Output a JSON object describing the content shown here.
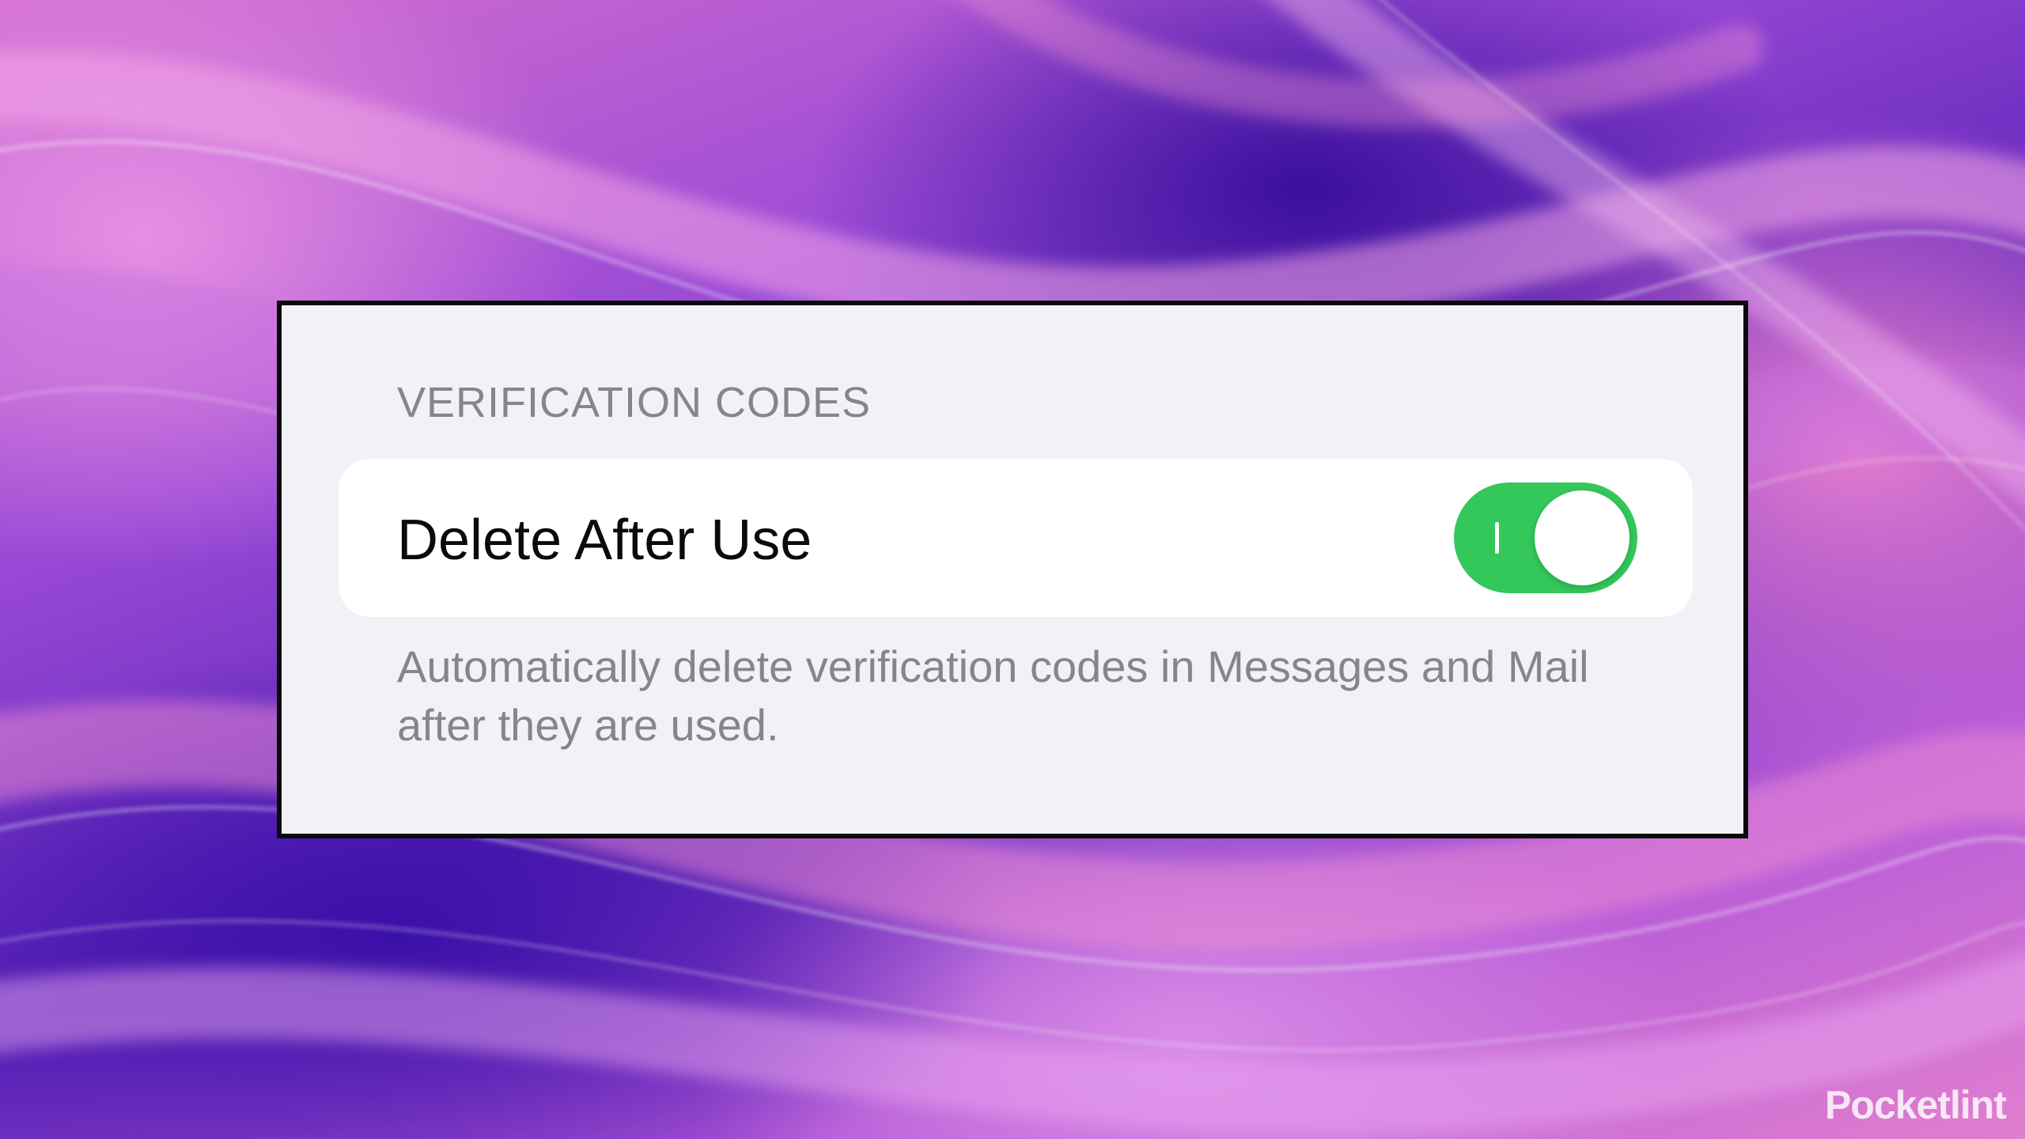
{
  "settings": {
    "section_header": "VERIFICATION CODES",
    "row_label": "Delete After Use",
    "toggle": {
      "state": "on",
      "on_color": "#34c759"
    },
    "footer": "Automatically delete verification codes in Messages and Mail after they are used."
  },
  "branding": {
    "watermark": "Pocketlint"
  },
  "colors": {
    "card_background": "#f2f1f7",
    "row_background": "#ffffff",
    "secondary_text": "#86858c",
    "primary_text": "#0b0b0b"
  }
}
